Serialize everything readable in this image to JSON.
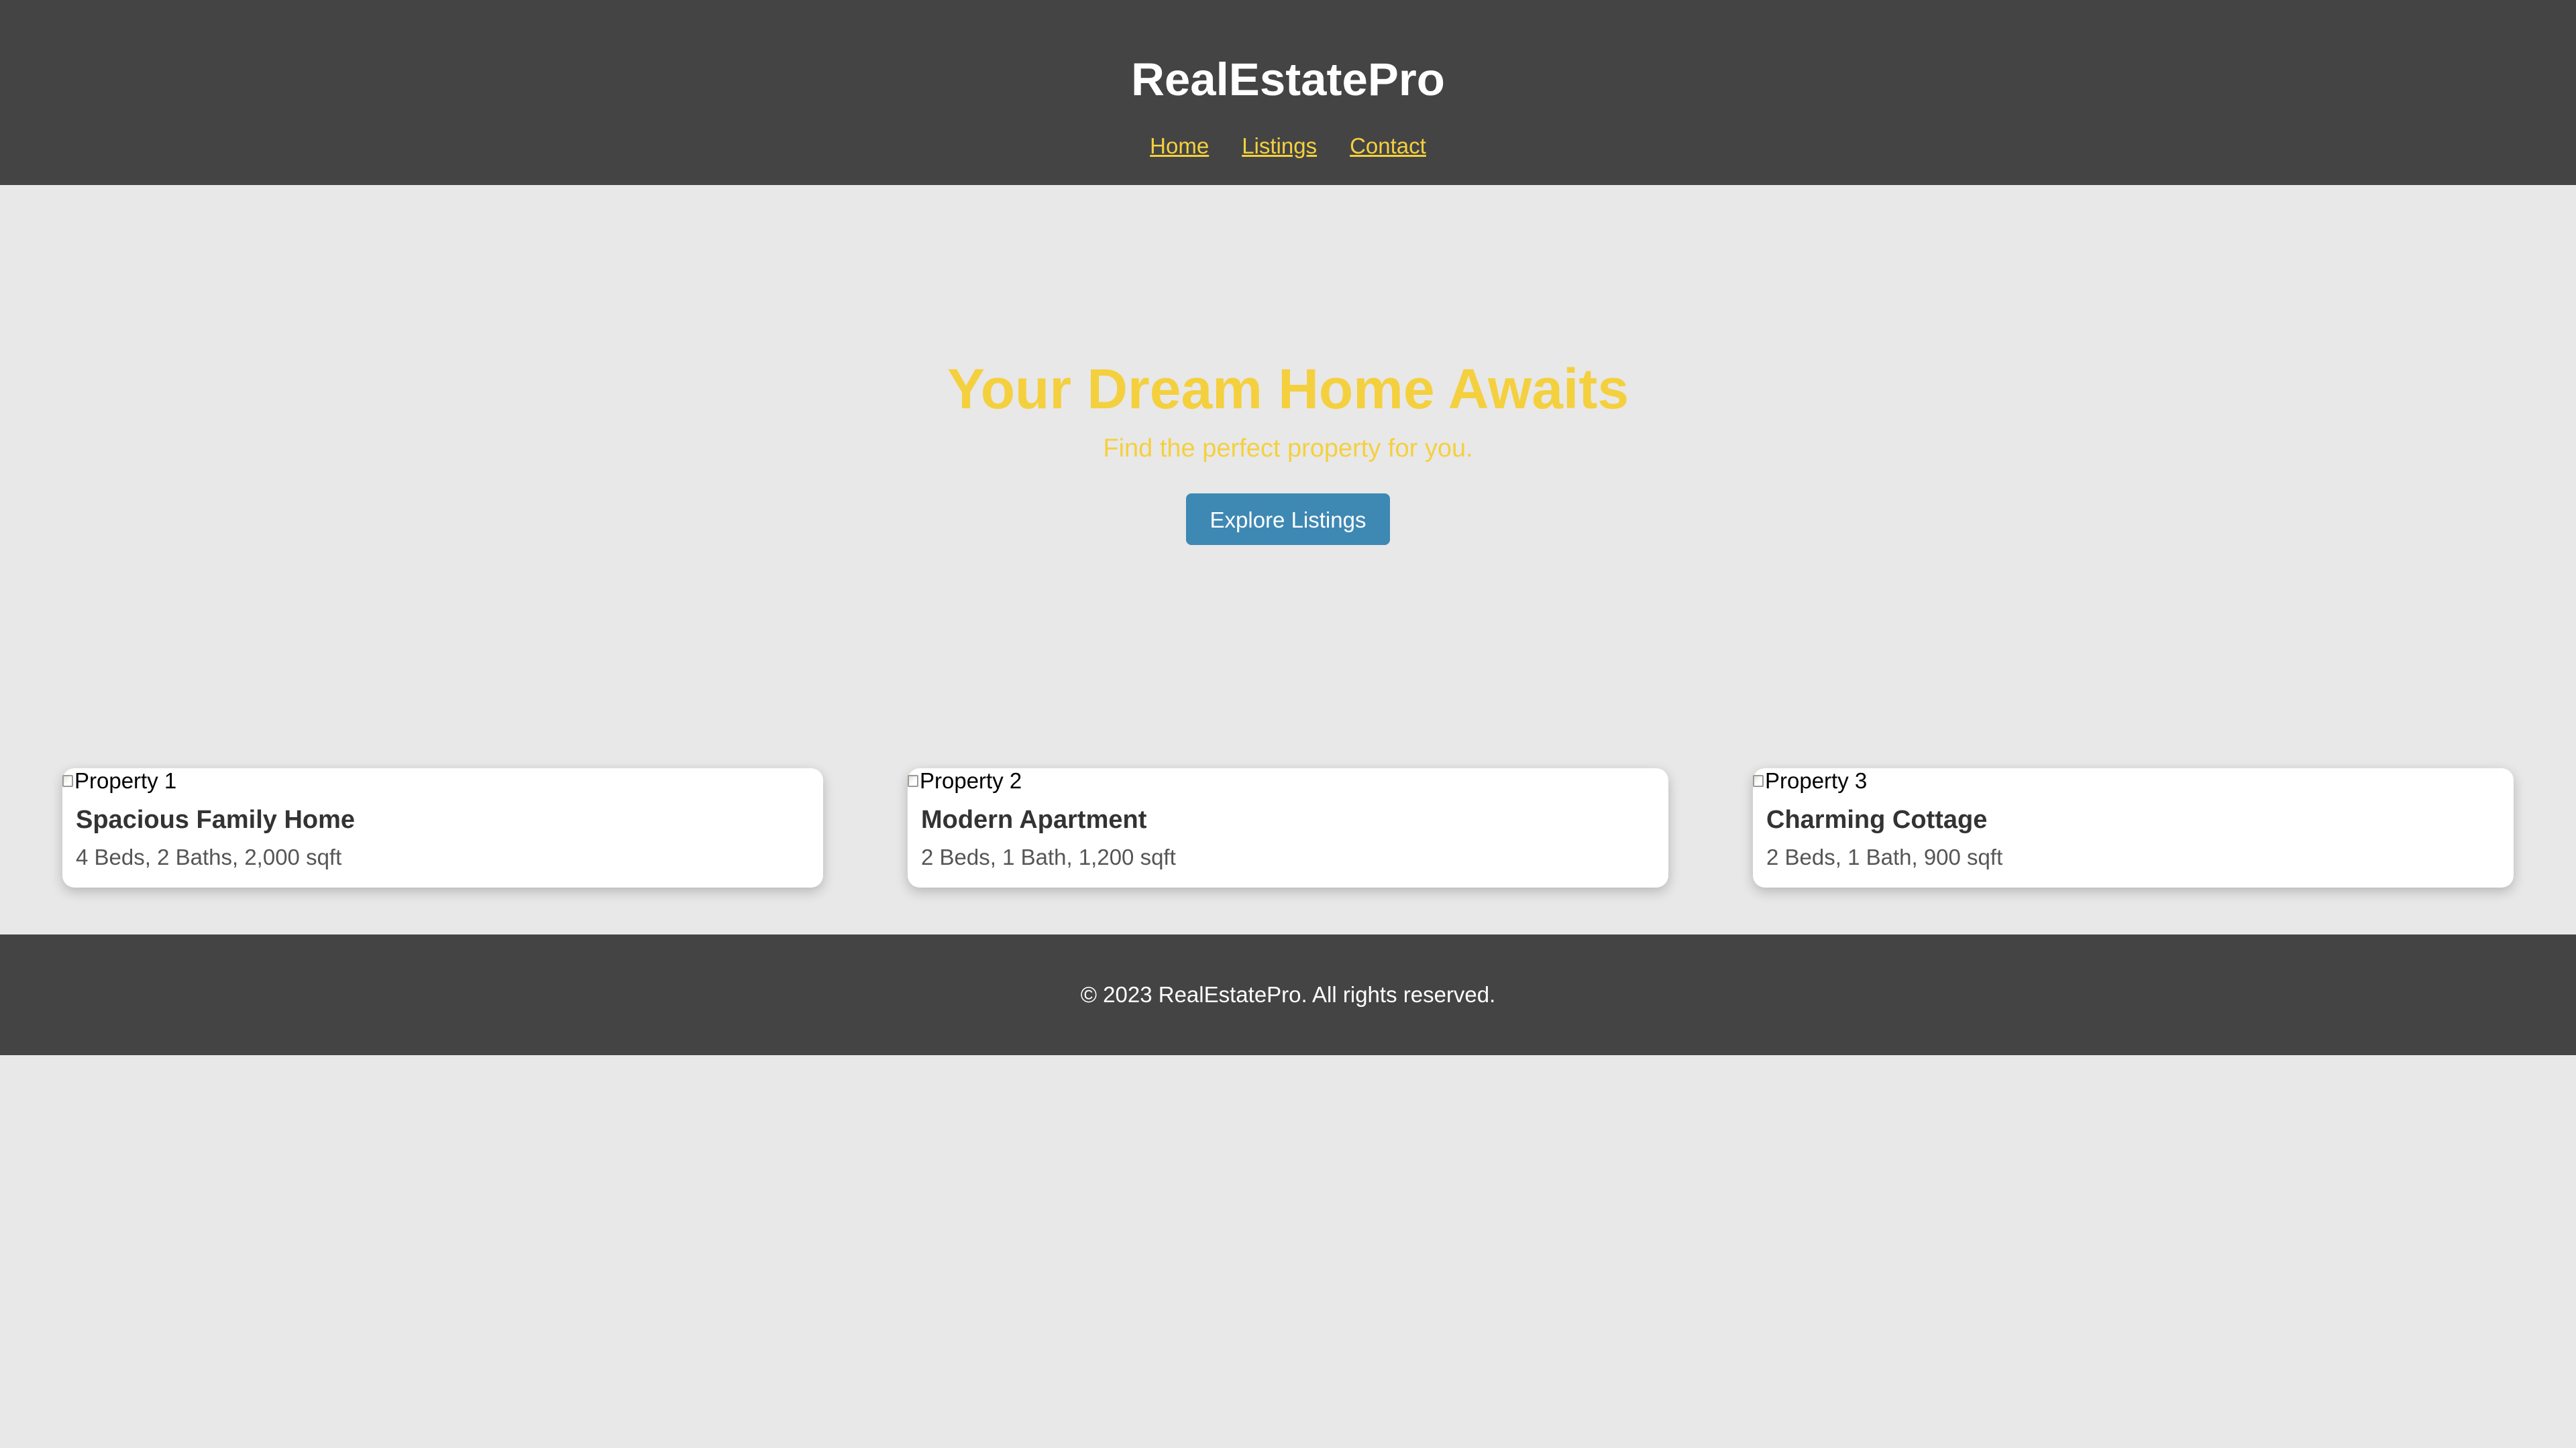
{
  "header": {
    "brand": "RealEstatePro",
    "nav": [
      {
        "label": "Home"
      },
      {
        "label": "Listings"
      },
      {
        "label": "Contact"
      }
    ]
  },
  "hero": {
    "title": "Your Dream Home Awaits",
    "subtitle": "Find the perfect property for you.",
    "cta_label": "Explore Listings"
  },
  "listings": [
    {
      "image_alt": "Property 1",
      "title": "Spacious Family Home",
      "details": "4 Beds, 2 Baths, 2,000 sqft"
    },
    {
      "image_alt": "Property 2",
      "title": "Modern Apartment",
      "details": "2 Beds, 1 Bath, 1,200 sqft"
    },
    {
      "image_alt": "Property 3",
      "title": "Charming Cottage",
      "details": "2 Beds, 1 Bath, 900 sqft"
    }
  ],
  "footer": {
    "text": "© 2023 RealEstatePro. All rights reserved."
  },
  "colors": {
    "header_bg": "#444444",
    "accent_yellow": "#f4d03f",
    "button_blue": "#3e88b4",
    "page_bg": "#e8e8e8"
  }
}
